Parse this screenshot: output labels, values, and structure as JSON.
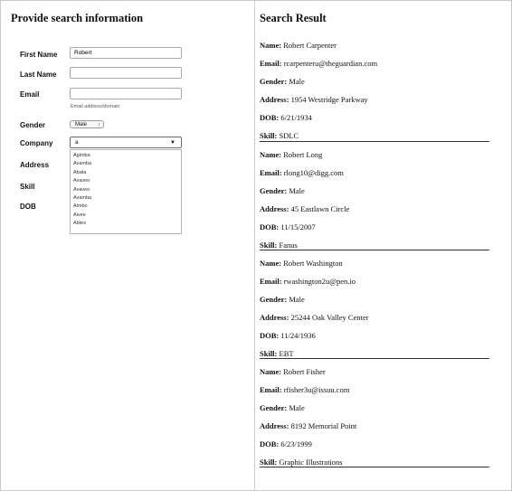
{
  "left": {
    "title": "Provide search information",
    "fields": {
      "first_name": {
        "label": "First Name",
        "value": "Robert"
      },
      "last_name": {
        "label": "Last Name",
        "value": ""
      },
      "email": {
        "label": "Email",
        "value": "",
        "help": "Email address/domain"
      },
      "gender": {
        "label": "Gender",
        "value": "Male"
      },
      "company": {
        "label": "Company",
        "value": "a"
      },
      "address": {
        "label": "Address"
      },
      "skill": {
        "label": "Skill"
      },
      "dob": {
        "label": "DOB"
      }
    },
    "company_options": [
      "Agimba",
      "Avamba",
      "Abata",
      "Avaveo",
      "Avaveo",
      "Avamba",
      "Aimbo",
      "Aivee",
      "Abtex"
    ]
  },
  "right": {
    "title": "Search Result",
    "labels": {
      "name": "Name:",
      "email": "Email:",
      "gender": "Gender:",
      "address": "Address:",
      "dob": "DOB:",
      "skill": "Skill:"
    },
    "results": [
      {
        "name": "Robert Carpenter",
        "email": "rcarpenteru@theguardian.com",
        "gender": "Male",
        "address": "1954 Westridge Parkway",
        "dob": "6/21/1934",
        "skill": "SDLC"
      },
      {
        "name": "Robert Long",
        "email": "rlong10@digg.com",
        "gender": "Male",
        "address": "45 Eastlawn Circle",
        "dob": "11/15/2007",
        "skill": "Fanus"
      },
      {
        "name": "Robert Washington",
        "email": "rwashington2u@pen.io",
        "gender": "Male",
        "address": "25244 Oak Valley Center",
        "dob": "11/24/1936",
        "skill": "EBT"
      },
      {
        "name": "Robert Fisher",
        "email": "rfisher3u@issuu.com",
        "gender": "Male",
        "address": "8192 Memorial Point",
        "dob": "6/23/1999",
        "skill": "Graphic Illustrations"
      }
    ]
  }
}
